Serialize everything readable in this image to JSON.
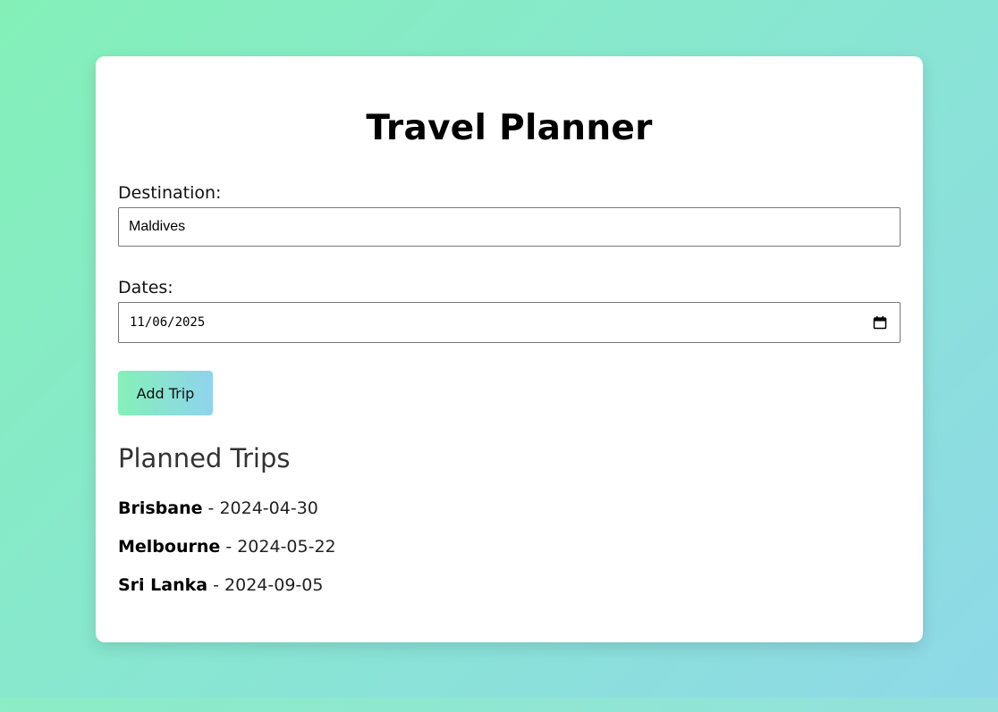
{
  "app": {
    "title": "Travel Planner"
  },
  "form": {
    "destination_label": "Destination:",
    "destination_value": "Maldives",
    "dates_label": "Dates:",
    "dates_value": "11/06/2025",
    "add_button_label": "Add Trip"
  },
  "trips": {
    "heading": "Planned Trips",
    "items": [
      {
        "destination": "Brisbane",
        "separator": " - ",
        "date": "2024-04-30"
      },
      {
        "destination": "Melbourne",
        "separator": " - ",
        "date": "2024-05-22"
      },
      {
        "destination": "Sri Lanka",
        "separator": " - ",
        "date": "2024-09-05"
      }
    ]
  },
  "icons": {
    "date_picker": "calendar-icon"
  },
  "colors": {
    "background_start": "#84f0b8",
    "background_end": "#8fd8e8",
    "card": "#ffffff",
    "button_start": "#84f0b8",
    "button_end": "#8fd3ee"
  }
}
